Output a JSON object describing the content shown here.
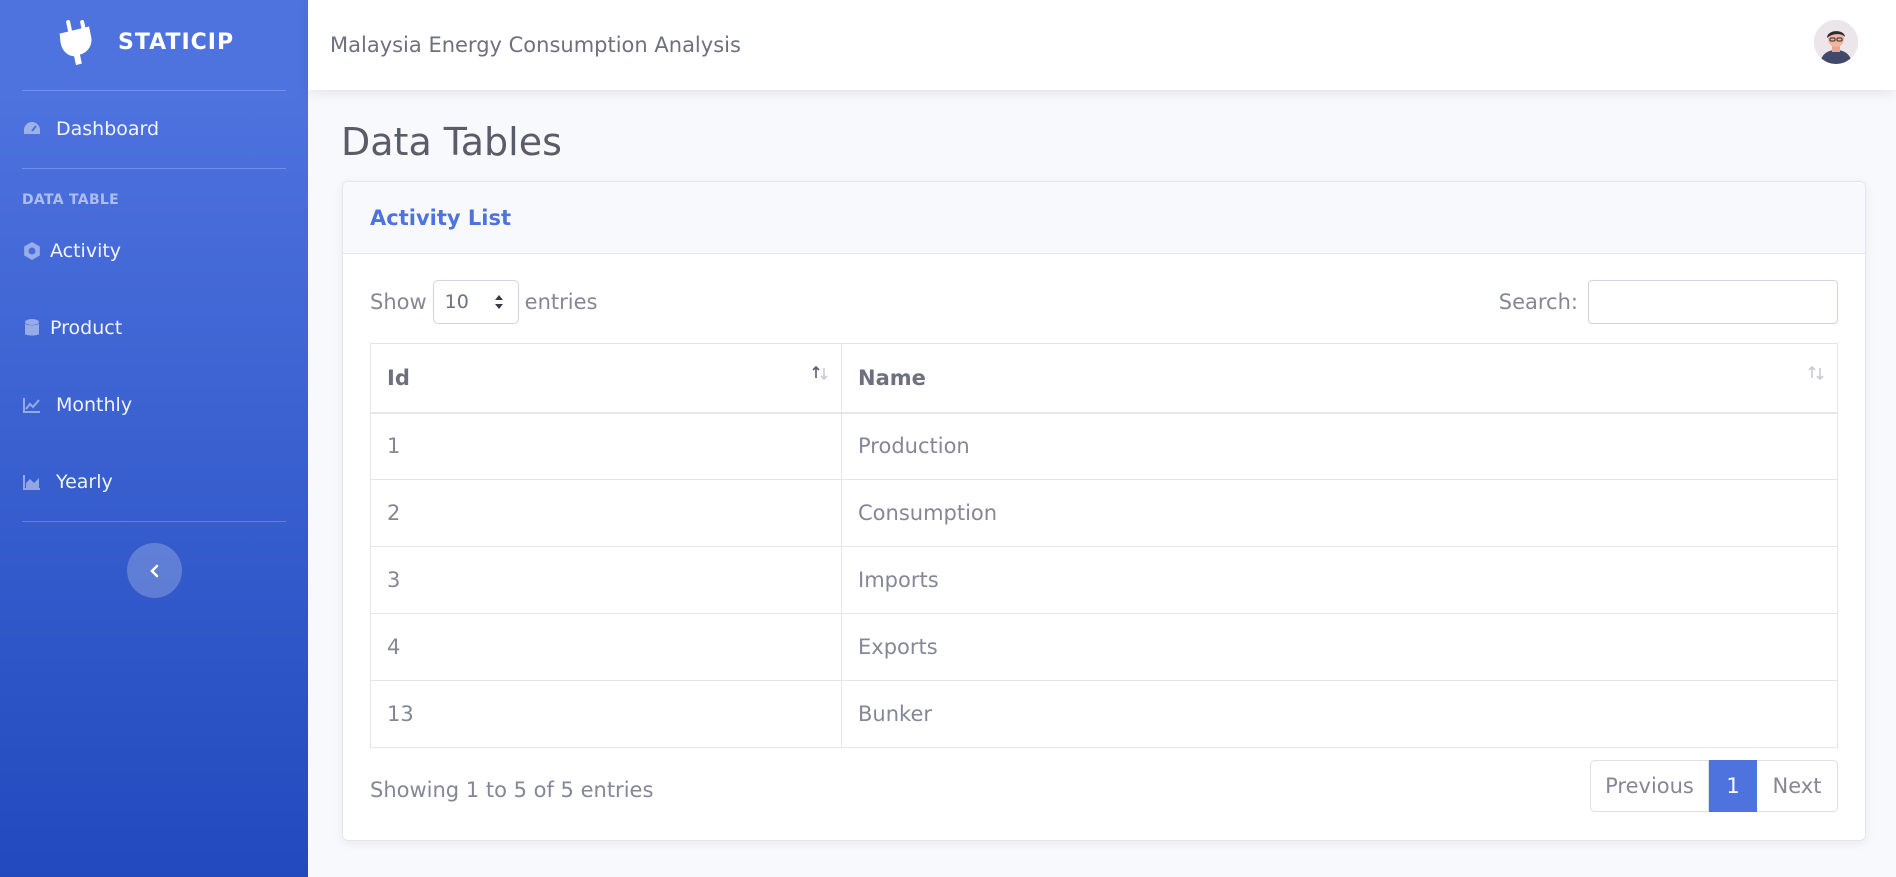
{
  "brand": {
    "name": "STATICIP",
    "icon": "plug-icon"
  },
  "sidebar": {
    "dashboard": {
      "label": "Dashboard",
      "icon": "tachometer-icon"
    },
    "heading": "DATA TABLE",
    "items": [
      {
        "label": "Activity",
        "icon": "cog-icon"
      },
      {
        "label": "Product",
        "icon": "database-icon"
      },
      {
        "label": "Monthly",
        "icon": "line-chart-icon"
      },
      {
        "label": "Yearly",
        "icon": "area-chart-icon"
      }
    ],
    "toggle_icon": "chevron-left-icon"
  },
  "topbar": {
    "title": "Malaysia Energy Consumption Analysis",
    "avatar": "user-avatar"
  },
  "page": {
    "title": "Data Tables"
  },
  "card": {
    "title": "Activity List",
    "length": {
      "prefix": "Show",
      "value": "10",
      "suffix": "entries"
    },
    "search": {
      "label": "Search:",
      "value": ""
    },
    "table": {
      "headers": [
        "Id",
        "Name"
      ],
      "rows": [
        [
          "1",
          "Production"
        ],
        [
          "2",
          "Consumption"
        ],
        [
          "3",
          "Imports"
        ],
        [
          "4",
          "Exports"
        ],
        [
          "13",
          "Bunker"
        ]
      ]
    },
    "info": "Showing 1 to 5 of 5 entries",
    "pagination": {
      "previous": "Previous",
      "current": "1",
      "next": "Next"
    }
  },
  "colors": {
    "primary": "#4e73df",
    "sidebar_end": "#224abe",
    "text": "#858796"
  }
}
